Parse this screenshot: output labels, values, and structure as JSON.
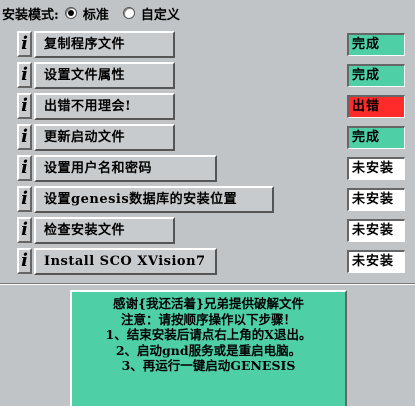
{
  "install_mode": {
    "label": "安装模式:",
    "options": [
      {
        "label": "标准",
        "selected": true
      },
      {
        "label": "自定义",
        "selected": false
      }
    ]
  },
  "info_glyph": "i",
  "steps": [
    {
      "label": "复制程序文件",
      "status": "完成",
      "state": "done"
    },
    {
      "label": "设置文件属性",
      "status": "完成",
      "state": "done"
    },
    {
      "label": "出错不用理会!",
      "status": "出错",
      "state": "error"
    },
    {
      "label": "更新启动文件",
      "status": "完成",
      "state": "done"
    },
    {
      "label": "设置用户名和密码",
      "status": "未安装",
      "state": "none"
    },
    {
      "label": "设置genesis数据库的安装位置",
      "status": "未安装",
      "state": "none"
    },
    {
      "label": "检查安装文件",
      "status": "未安装",
      "state": "none"
    },
    {
      "label": "Install SCO XVision7",
      "status": "未安装",
      "state": "none"
    }
  ],
  "note": {
    "lines": [
      "感谢{我还活着}兄弟提供破解文件",
      "注意：请按顺序操作以下步骤！",
      "1、结束安装后请点右上角的X退出。",
      "2、启动gnd服务或是重启电脑。",
      "3、再运行一键启动GENESIS"
    ]
  },
  "colors": {
    "done": "#4fcfa6",
    "error": "#ff2a2a",
    "none": "#ffffff",
    "background": "#c0c4c6"
  }
}
